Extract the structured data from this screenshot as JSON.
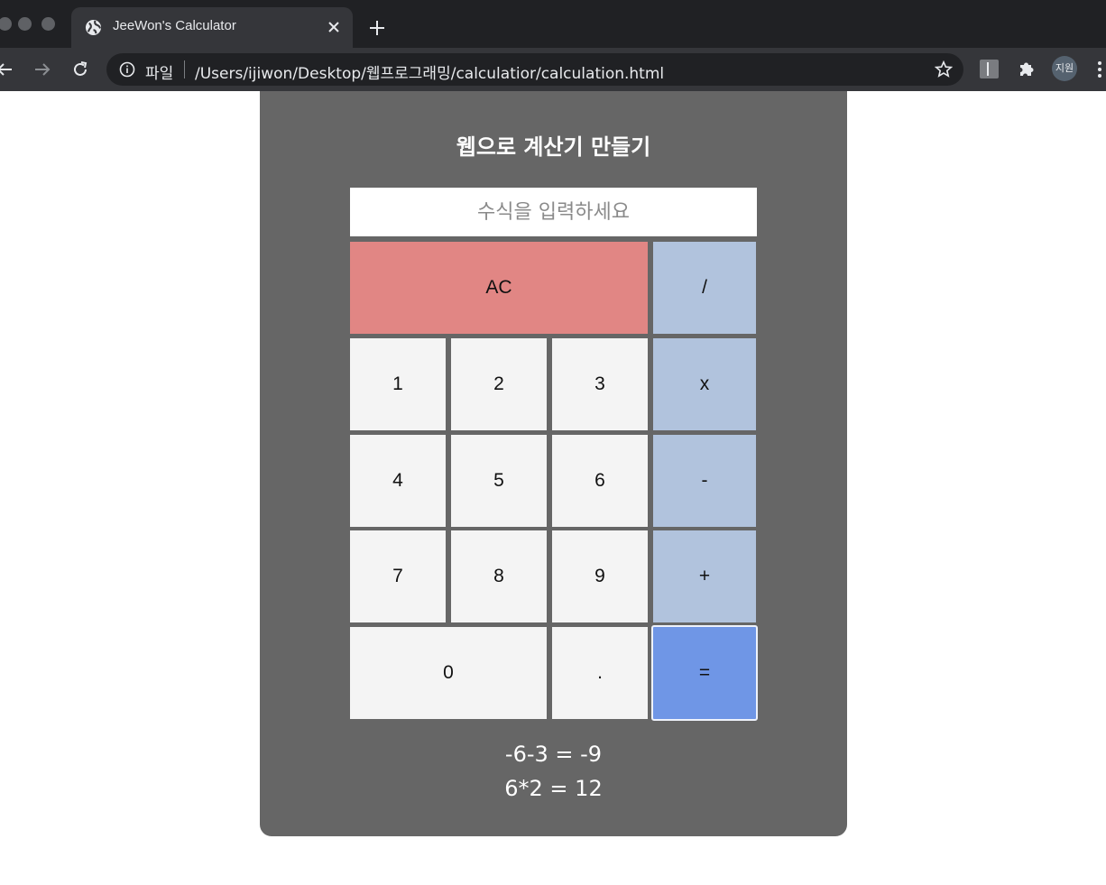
{
  "browser": {
    "tab_title": "JeeWon's Calculator",
    "scheme_label": "파일",
    "url": "/Users/ijiwon/Desktop/웹프로그래밍/calculatior/calculation.html",
    "profile_initials": "지원"
  },
  "calculator": {
    "title": "웹으로 계산기 만들기",
    "input_placeholder": "수식을 입력하세요",
    "input_value": "",
    "keys": {
      "clear": "AC",
      "divide": "/",
      "multiply": "x",
      "subtract": "-",
      "add": "+",
      "equals": "=",
      "dot": ".",
      "d0": "0",
      "d1": "1",
      "d2": "2",
      "d3": "3",
      "d4": "4",
      "d5": "5",
      "d6": "6",
      "d7": "7",
      "d8": "8",
      "d9": "9"
    },
    "history": [
      "-6-3 = -9",
      "6*2 = 12"
    ]
  },
  "colors": {
    "card_bg": "#666666",
    "number_key": "#f4f4f4",
    "operator_key": "#b1c3dd",
    "clear_key": "#e18684",
    "equals_key": "#6f96e6"
  }
}
